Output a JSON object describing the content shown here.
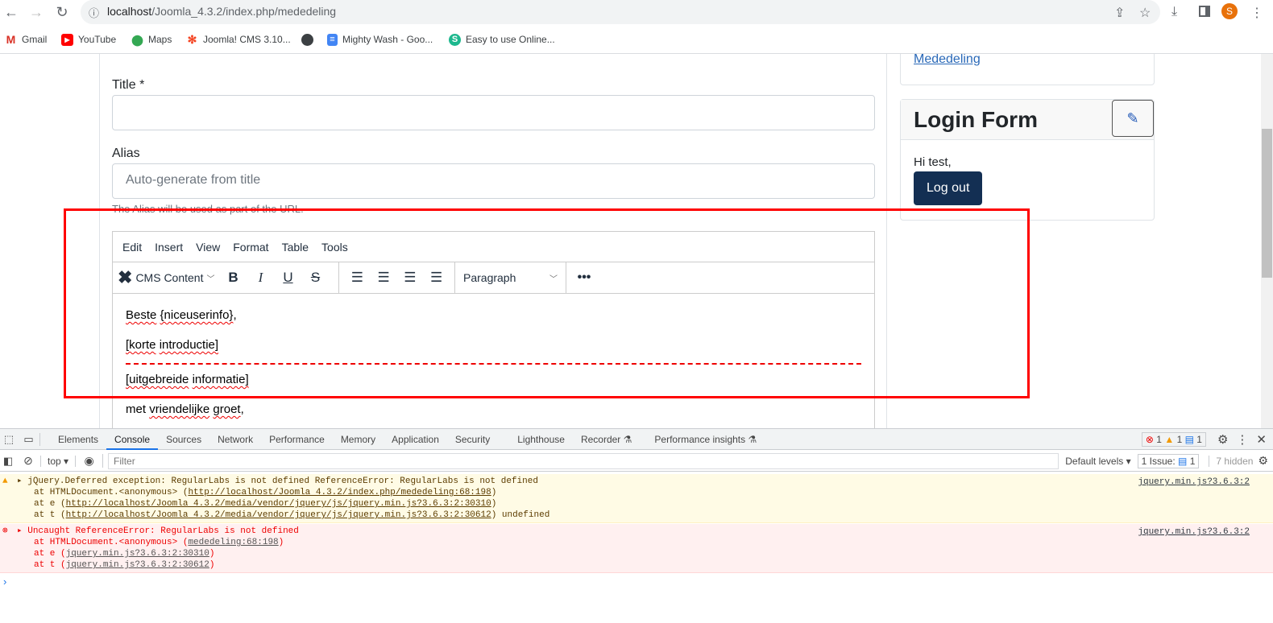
{
  "browser": {
    "url_host": "localhost",
    "url_path": "/Joomla_4.3.2/index.php/mededeling",
    "profile_initial": "S",
    "bookmarks": [
      {
        "label": "Gmail",
        "icon": "gmail-icon"
      },
      {
        "label": "YouTube",
        "icon": "youtube-icon"
      },
      {
        "label": "Maps",
        "icon": "maps-icon"
      },
      {
        "label": "Joomla! CMS 3.10...",
        "icon": "joomla-icon"
      },
      {
        "label": "",
        "icon": "globe-icon"
      },
      {
        "label": "Mighty Wash - Goo...",
        "icon": "docs-icon"
      },
      {
        "label": "Easy to use Online...",
        "icon": "s-icon"
      }
    ]
  },
  "form": {
    "title_label": "Title *",
    "title_value": "",
    "alias_label": "Alias",
    "alias_placeholder": "Auto-generate from title",
    "alias_help": "The Alias will be used as part of the URL."
  },
  "editor": {
    "menu": [
      "Edit",
      "Insert",
      "View",
      "Format",
      "Table",
      "Tools"
    ],
    "cms_content_label": "CMS Content",
    "block_format": "Paragraph",
    "content": {
      "p1_a": "Beste",
      "p1_b": "{niceuserinfo}",
      "p1_c": ",",
      "p2_a": "[korte",
      "p2_b": "introductie]",
      "p3_a": "[uitgebreide",
      "p3_b": "informatie]",
      "p4_a": "met",
      "p4_b": "vriendelijke",
      "p4_c": "groet",
      "p4_d": ","
    }
  },
  "sidebar": {
    "menu_link": "Mededeling",
    "login_title": "Login Form",
    "greeting": "Hi test,",
    "logout_label": "Log out"
  },
  "devtools": {
    "tabs": [
      "Elements",
      "Console",
      "Sources",
      "Network",
      "Performance",
      "Memory",
      "Application",
      "Security",
      "Lighthouse",
      "Recorder",
      "Performance insights"
    ],
    "active_tab": "Console",
    "context": "top",
    "filter_placeholder": "Filter",
    "levels": "Default levels",
    "issues_label": "1 Issue:",
    "issues_count": "1",
    "hidden": "7 hidden",
    "error_count": "1",
    "warning_count": "1",
    "info_count": "1",
    "messages": [
      {
        "level": "warning",
        "text": "jQuery.Deferred exception: RegularLabs is not defined ReferenceError: RegularLabs is not defined",
        "source": "jquery.min.js?3.6.3:2",
        "stack": [
          {
            "prefix": "at HTMLDocument.<anonymous> (",
            "link": "http://localhost/Joomla 4.3.2/index.php/mededeling:68:198",
            "suffix": ")"
          },
          {
            "prefix": "at e (",
            "link": "http://localhost/Joomla 4.3.2/media/vendor/jquery/js/jquery.min.js?3.6.3:2:30310",
            "suffix": ")"
          },
          {
            "prefix": "at t (",
            "link": "http://localhost/Joomla 4.3.2/media/vendor/jquery/js/jquery.min.js?3.6.3:2:30612",
            "suffix": ") undefined"
          }
        ]
      },
      {
        "level": "error",
        "text": "Uncaught ReferenceError: RegularLabs is not defined",
        "source": "jquery.min.js?3.6.3:2",
        "stack": [
          {
            "prefix": "at HTMLDocument.<anonymous> (",
            "link": "mededeling:68:198",
            "suffix": ")"
          },
          {
            "prefix": "at e (",
            "link": "jquery.min.js?3.6.3:2:30310",
            "suffix": ")"
          },
          {
            "prefix": "at t (",
            "link": "jquery.min.js?3.6.3:2:30612",
            "suffix": ")"
          }
        ]
      }
    ]
  },
  "colors": {
    "highlight_box": "#ff0000",
    "logout_bg": "#132f53",
    "link": "#2a69b8"
  }
}
